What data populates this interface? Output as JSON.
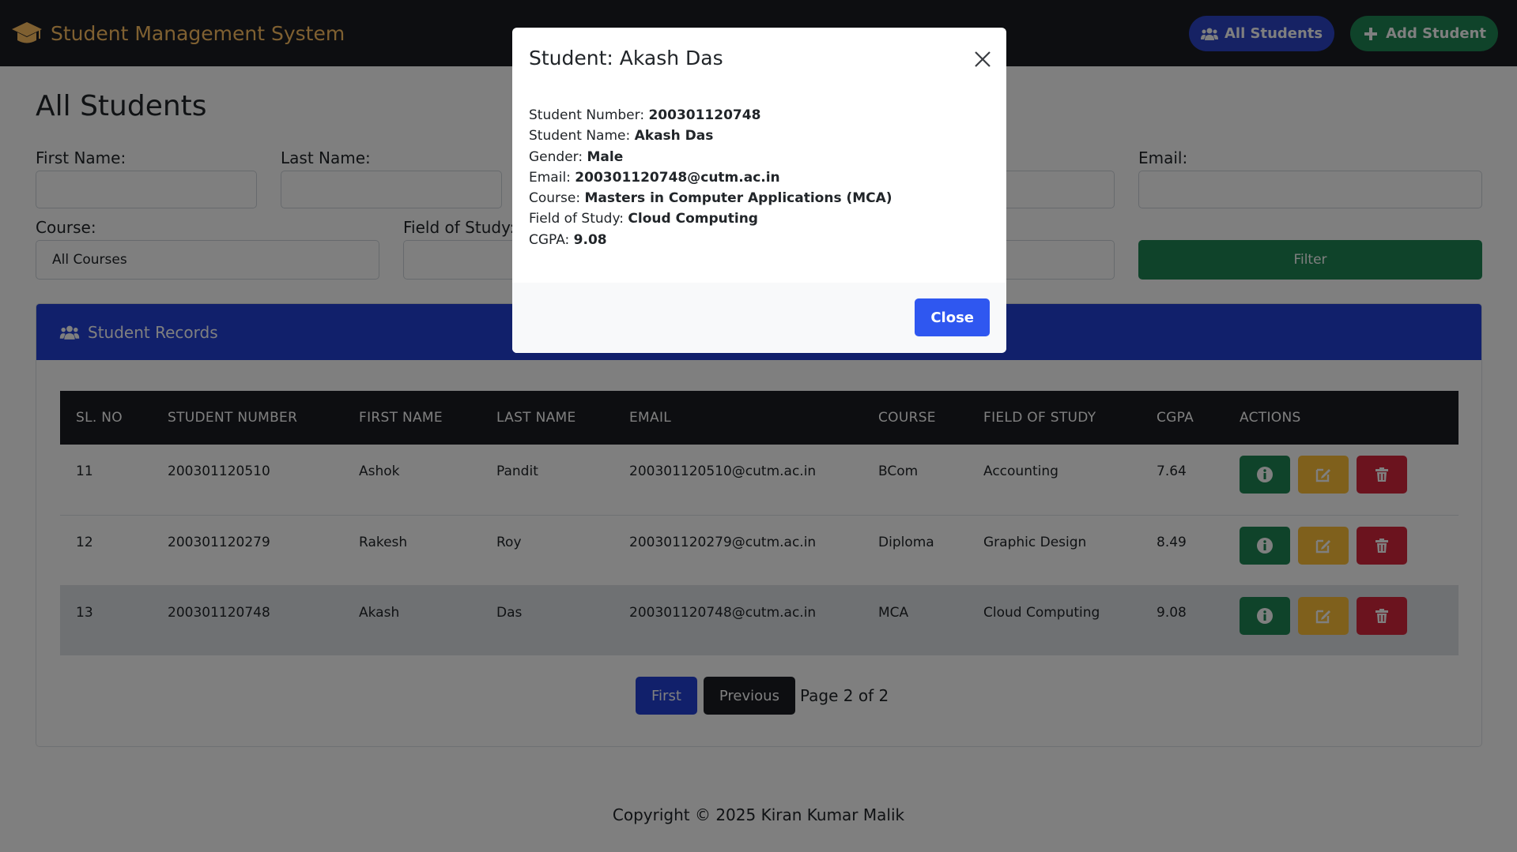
{
  "app": {
    "title": "Student Management System"
  },
  "nav": {
    "all_students": "All Students",
    "add_student": "Add Student"
  },
  "page": {
    "title": "All Students"
  },
  "filters": {
    "first_name_label": "First Name:",
    "last_name_label": "Last Name:",
    "email_label": "Email:",
    "course_label": "Course:",
    "course_value": "All Courses",
    "field_label": "Field of Study:",
    "filter_button": "Filter"
  },
  "records": {
    "title": "Student Records",
    "columns": [
      "SL. NO",
      "STUDENT NUMBER",
      "FIRST NAME",
      "LAST NAME",
      "EMAIL",
      "COURSE",
      "FIELD OF STUDY",
      "CGPA",
      "ACTIONS"
    ],
    "rows": [
      [
        "11",
        "200301120510",
        "Ashok",
        "Pandit",
        "200301120510@cutm.ac.in",
        "BCom",
        "Accounting",
        "7.64"
      ],
      [
        "12",
        "200301120279",
        "Rakesh",
        "Roy",
        "200301120279@cutm.ac.in",
        "Diploma",
        "Graphic Design",
        "8.49"
      ],
      [
        "13",
        "200301120748",
        "Akash",
        "Das",
        "200301120748@cutm.ac.in",
        "MCA",
        "Cloud Computing",
        "9.08"
      ]
    ]
  },
  "pagination": {
    "first": "First",
    "previous": "Previous",
    "page_text": "Page 2 of 2"
  },
  "footer": {
    "text": "Copyright © 2025 Kiran Kumar Malik"
  },
  "modal": {
    "title": "Student: Akash Das",
    "details": [
      {
        "label": "Student Number: ",
        "value": "200301120748"
      },
      {
        "label": "Student Name: ",
        "value": "Akash Das"
      },
      {
        "label": "Gender: ",
        "value": "Male"
      },
      {
        "label": "Email: ",
        "value": "200301120748@cutm.ac.in"
      },
      {
        "label": "Course: ",
        "value": "Masters in Computer Applications (MCA)"
      },
      {
        "label": "Field of Study: ",
        "value": "Cloud Computing"
      },
      {
        "label": "CGPA: ",
        "value": "9.08"
      }
    ],
    "close_button": "Close"
  },
  "colors": {
    "brand": "#ffc062",
    "primary": "#2341d6",
    "success": "#1f8754",
    "warning": "#ffc038",
    "danger": "#d7263d",
    "dark": "#1a1d22"
  },
  "icons": {
    "brand": "graduation-cap-icon",
    "users": "users-icon",
    "plus": "plus-icon",
    "info": "info-icon",
    "edit": "edit-icon",
    "delete": "trash-icon",
    "close": "close-icon"
  }
}
